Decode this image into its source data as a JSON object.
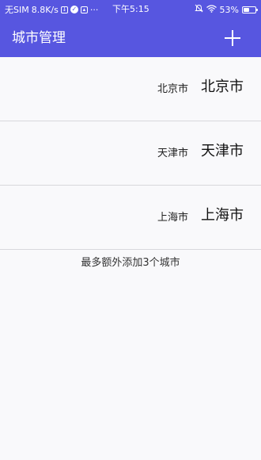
{
  "status_bar": {
    "carrier": "无SIM",
    "speed": "8.8K/s",
    "dots": "···",
    "time": "下午5:15",
    "battery_percent": "53%",
    "battery_level": 0.53,
    "icons": [
      "download-icon",
      "check-icon",
      "image-icon",
      "alarm-muted-icon",
      "wifi-icon",
      "battery-icon"
    ]
  },
  "app_bar": {
    "title": "城市管理",
    "add_icon": "plus-icon",
    "color": "#5756e0"
  },
  "cities": [
    {
      "small_name": "北京市",
      "large_name": "北京市"
    },
    {
      "small_name": "天津市",
      "large_name": "天津市"
    },
    {
      "small_name": "上海市",
      "large_name": "上海市"
    }
  ],
  "footer_note": "最多额外添加3个城市"
}
